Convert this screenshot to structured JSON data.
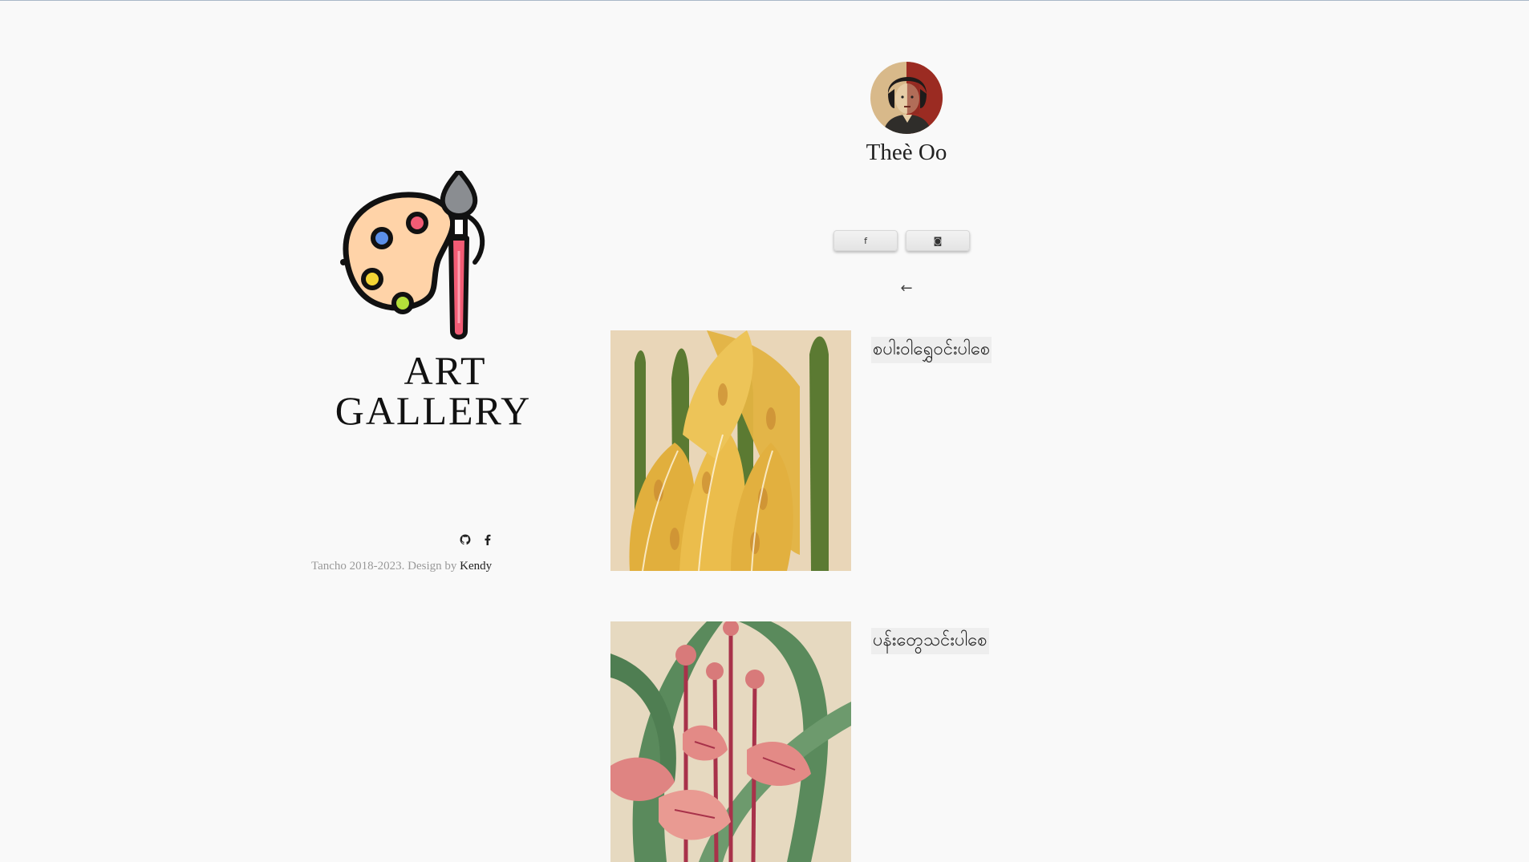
{
  "brand": {
    "line1": "ART",
    "line2": "GALLERY"
  },
  "footer": {
    "icons": [
      "github-icon",
      "facebook-icon"
    ],
    "copyright_prefix": "Tancho 2018-2023. Design by",
    "designer": "Kendy"
  },
  "profile": {
    "name": "Theè Oo",
    "social": [
      {
        "icon": "facebook-icon",
        "glyph": "f"
      },
      {
        "icon": "instagram-icon",
        "glyph": "◙"
      }
    ],
    "back_glyph": "←"
  },
  "posts": [
    {
      "title": "စပါးဝါရွှေဝင်းပါစေ"
    },
    {
      "title": "ပန်းတွေသင်းပါစေ"
    }
  ],
  "colors": {
    "background": "#f9f9f9",
    "palette_skin": "#ffd3a8",
    "brush_red": "#f25c75",
    "brush_gray": "#8a8d91",
    "avatar_red": "#9b2b22"
  }
}
